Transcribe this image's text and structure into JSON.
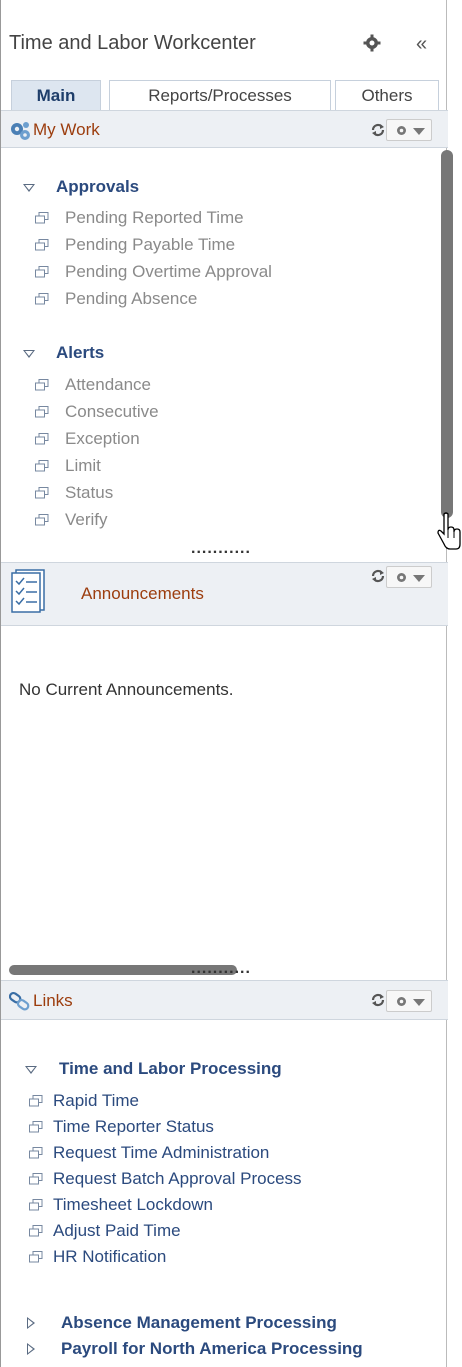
{
  "header": {
    "title": "Time and Labor Workcenter",
    "settings_icon": "gear-icon",
    "collapse_label": "«"
  },
  "tabs": [
    {
      "label": "Main",
      "active": true
    },
    {
      "label": "Reports/Processes",
      "active": false
    },
    {
      "label": "Others",
      "active": false
    }
  ],
  "my_work": {
    "title": "My Work",
    "groups": [
      {
        "label": "Approvals",
        "expanded": true,
        "items": [
          "Pending Reported Time",
          "Pending Payable Time",
          "Pending Overtime Approval",
          "Pending Absence"
        ]
      },
      {
        "label": "Alerts",
        "expanded": true,
        "items": [
          "Attendance",
          "Consecutive",
          "Exception",
          "Limit",
          "Status",
          "Verify"
        ]
      }
    ]
  },
  "announcements": {
    "title": "Announcements",
    "empty_message": "No Current Announcements."
  },
  "links": {
    "title": "Links",
    "groups": [
      {
        "label": "Time and Labor Processing",
        "expanded": true,
        "items": [
          "Rapid Time",
          "Time Reporter Status",
          "Request Time Administration",
          "Request Batch Approval Process",
          "Timesheet Lockdown",
          "Adjust Paid Time",
          "HR Notification"
        ]
      },
      {
        "label": "Absence Management Processing",
        "expanded": false,
        "items": []
      },
      {
        "label": "Payroll for North America Processing",
        "expanded": false,
        "items": []
      }
    ]
  },
  "resize_handle": "...........",
  "colors": {
    "pagelet_title": "#9c3d0e",
    "link_blue": "#2b4a7e",
    "item_grey": "#8a8a8a",
    "tab_active_bg": "#dde6f0"
  }
}
